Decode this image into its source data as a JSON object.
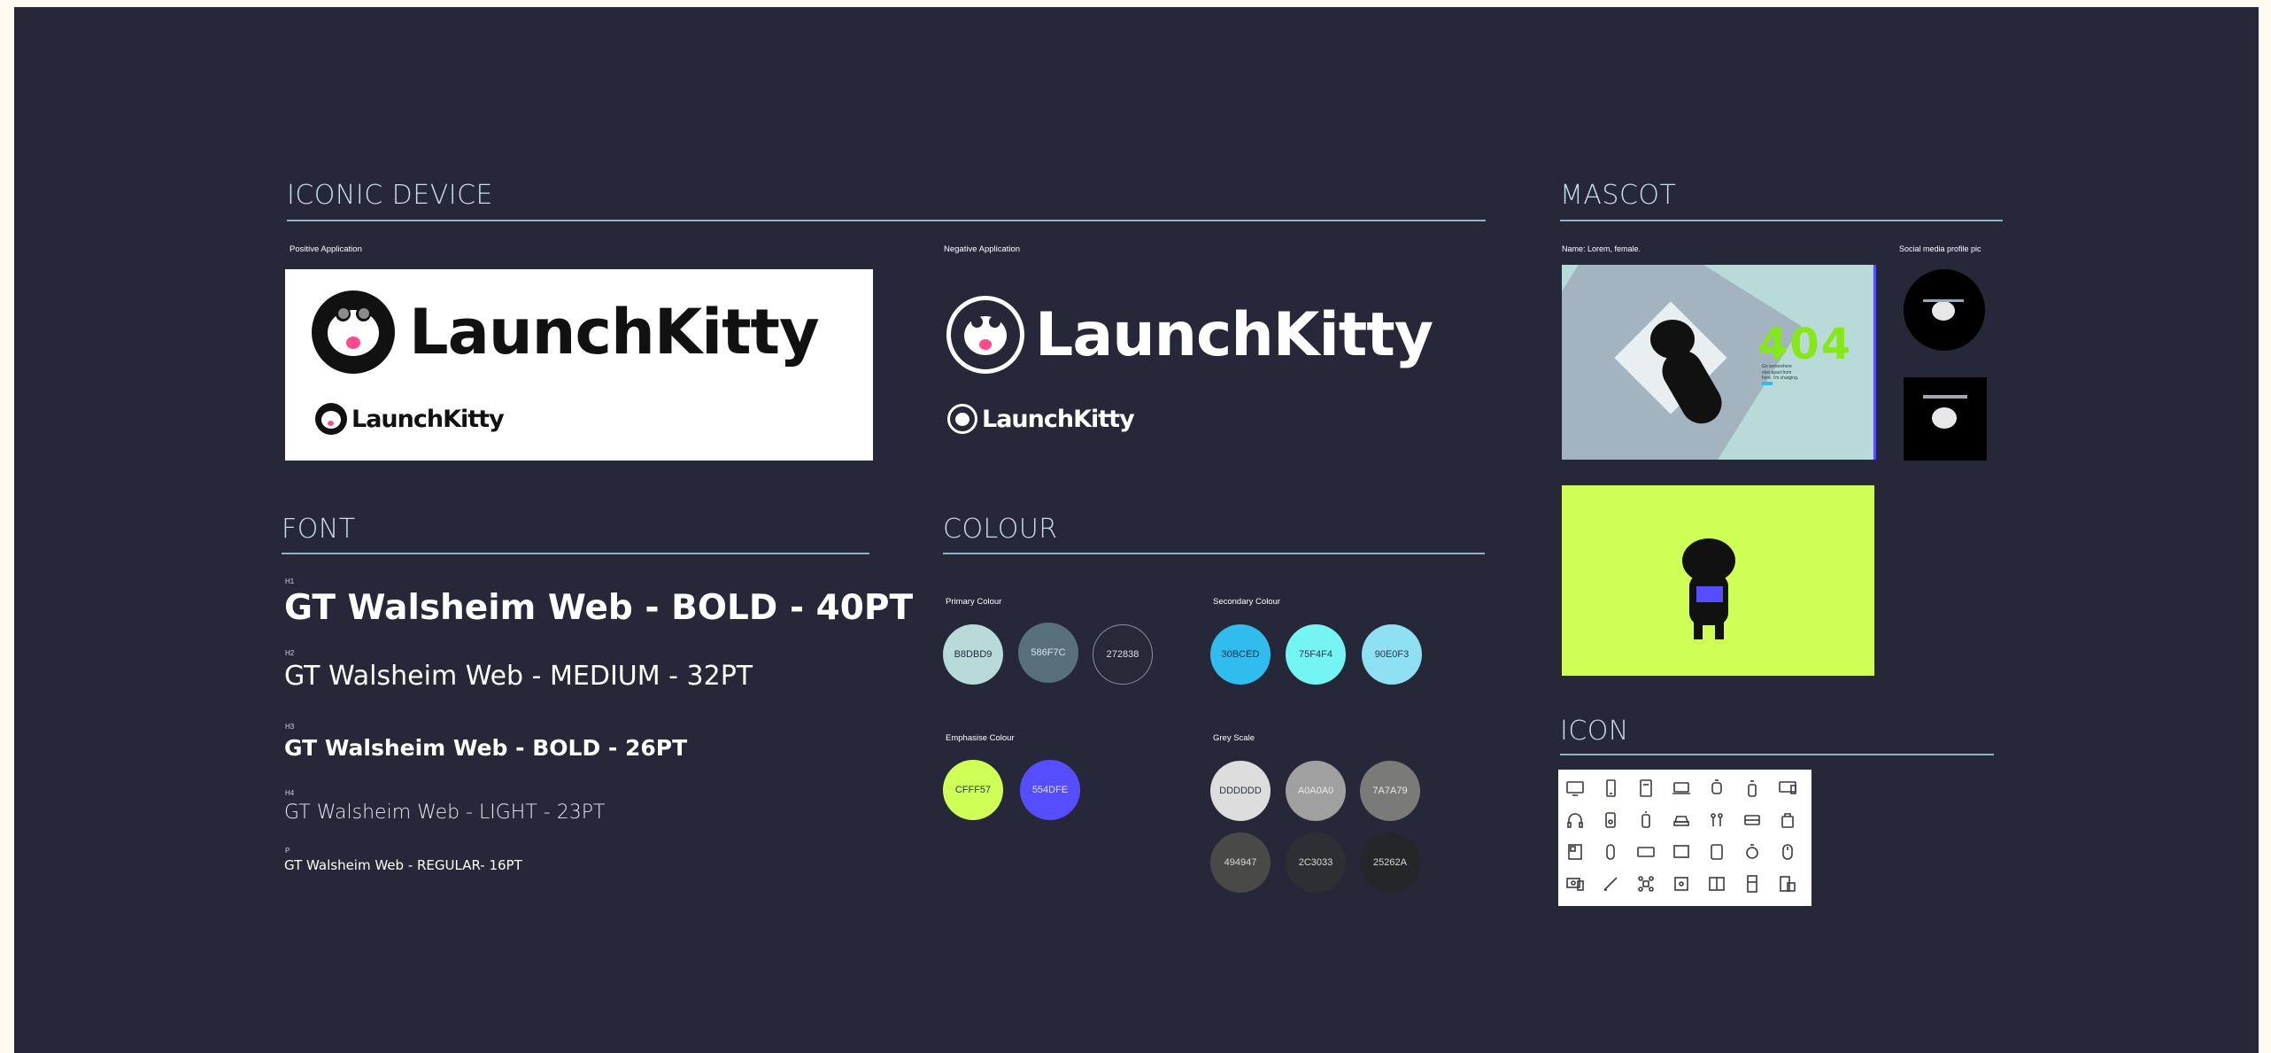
{
  "iconic": {
    "title": "ICONIC DEVICE",
    "positive_caption": "Positive Application",
    "negative_caption": "Negative Application",
    "brand": "LaunchKitty"
  },
  "font": {
    "title": "FONT",
    "specs": [
      {
        "tag": "H1",
        "text": "GT Walsheim Web - BOLD - 40PT"
      },
      {
        "tag": "H2",
        "text": "GT Walsheim Web - MEDIUM - 32PT"
      },
      {
        "tag": "H3",
        "text": "GT Walsheim Web - BOLD - 26PT"
      },
      {
        "tag": "H4",
        "text": "GT Walsheim Web - LIGHT - 23PT"
      },
      {
        "tag": "P",
        "text": "GT Walsheim Web - REGULAR- 16PT"
      }
    ]
  },
  "colour": {
    "title": "COLOUR",
    "primary_label": "Primary Colour",
    "secondary_label": "Secondary Colour",
    "emphasise_label": "Emphasise Colour",
    "grey_label": "Grey Scale",
    "primary": [
      {
        "code": "B8DBD9",
        "color": "#b8dbd9"
      },
      {
        "code": "586F7C",
        "color": "#586f7c"
      },
      {
        "code": "272838",
        "color": "#272838"
      }
    ],
    "secondary": [
      {
        "code": "30BCED",
        "color": "#30bced"
      },
      {
        "code": "75F4F4",
        "color": "#75f4f4"
      },
      {
        "code": "90E0F3",
        "color": "#90e0f3"
      }
    ],
    "emphasise": [
      {
        "code": "CFFF57",
        "color": "#cfff57"
      },
      {
        "code": "554DFE",
        "color": "#554dfe"
      }
    ],
    "grey": [
      {
        "code": "DDDDDD",
        "color": "#dddddd"
      },
      {
        "code": "A0A0A0",
        "color": "#a0a0a0"
      },
      {
        "code": "7A7A79",
        "color": "#7a7a79"
      },
      {
        "code": "494947",
        "color": "#494947"
      },
      {
        "code": "2C3033",
        "color": "#2c3033"
      },
      {
        "code": "25262A",
        "color": "#25262a"
      }
    ]
  },
  "mascot": {
    "title": "MASCOT",
    "name_caption": "Name: Lorem, female.",
    "social_caption": "Social media profile pic",
    "error_code": "404",
    "error_text": "Go somewhere else apart from here. I'm charging.",
    "yellow_bg": "#cfff57"
  },
  "icon": {
    "title": "ICON",
    "icons": [
      "monitor-icon",
      "phone-icon",
      "tablet-icon",
      "laptop-icon",
      "watch-icon",
      "bottle-icon",
      "display-icon",
      "headphones-icon",
      "speaker-icon",
      "cup-icon",
      "car-icon",
      "earbuds-icon",
      "printer-icon",
      "bag-icon",
      "frame-icon",
      "capsule-icon",
      "card-icon",
      "tv-icon",
      "square-icon",
      "clock-icon",
      "mouse-icon",
      "projector-icon",
      "pen-icon",
      "drone-icon",
      "camera-icon",
      "book-icon",
      "fridge-icon",
      "devices-icon"
    ]
  }
}
